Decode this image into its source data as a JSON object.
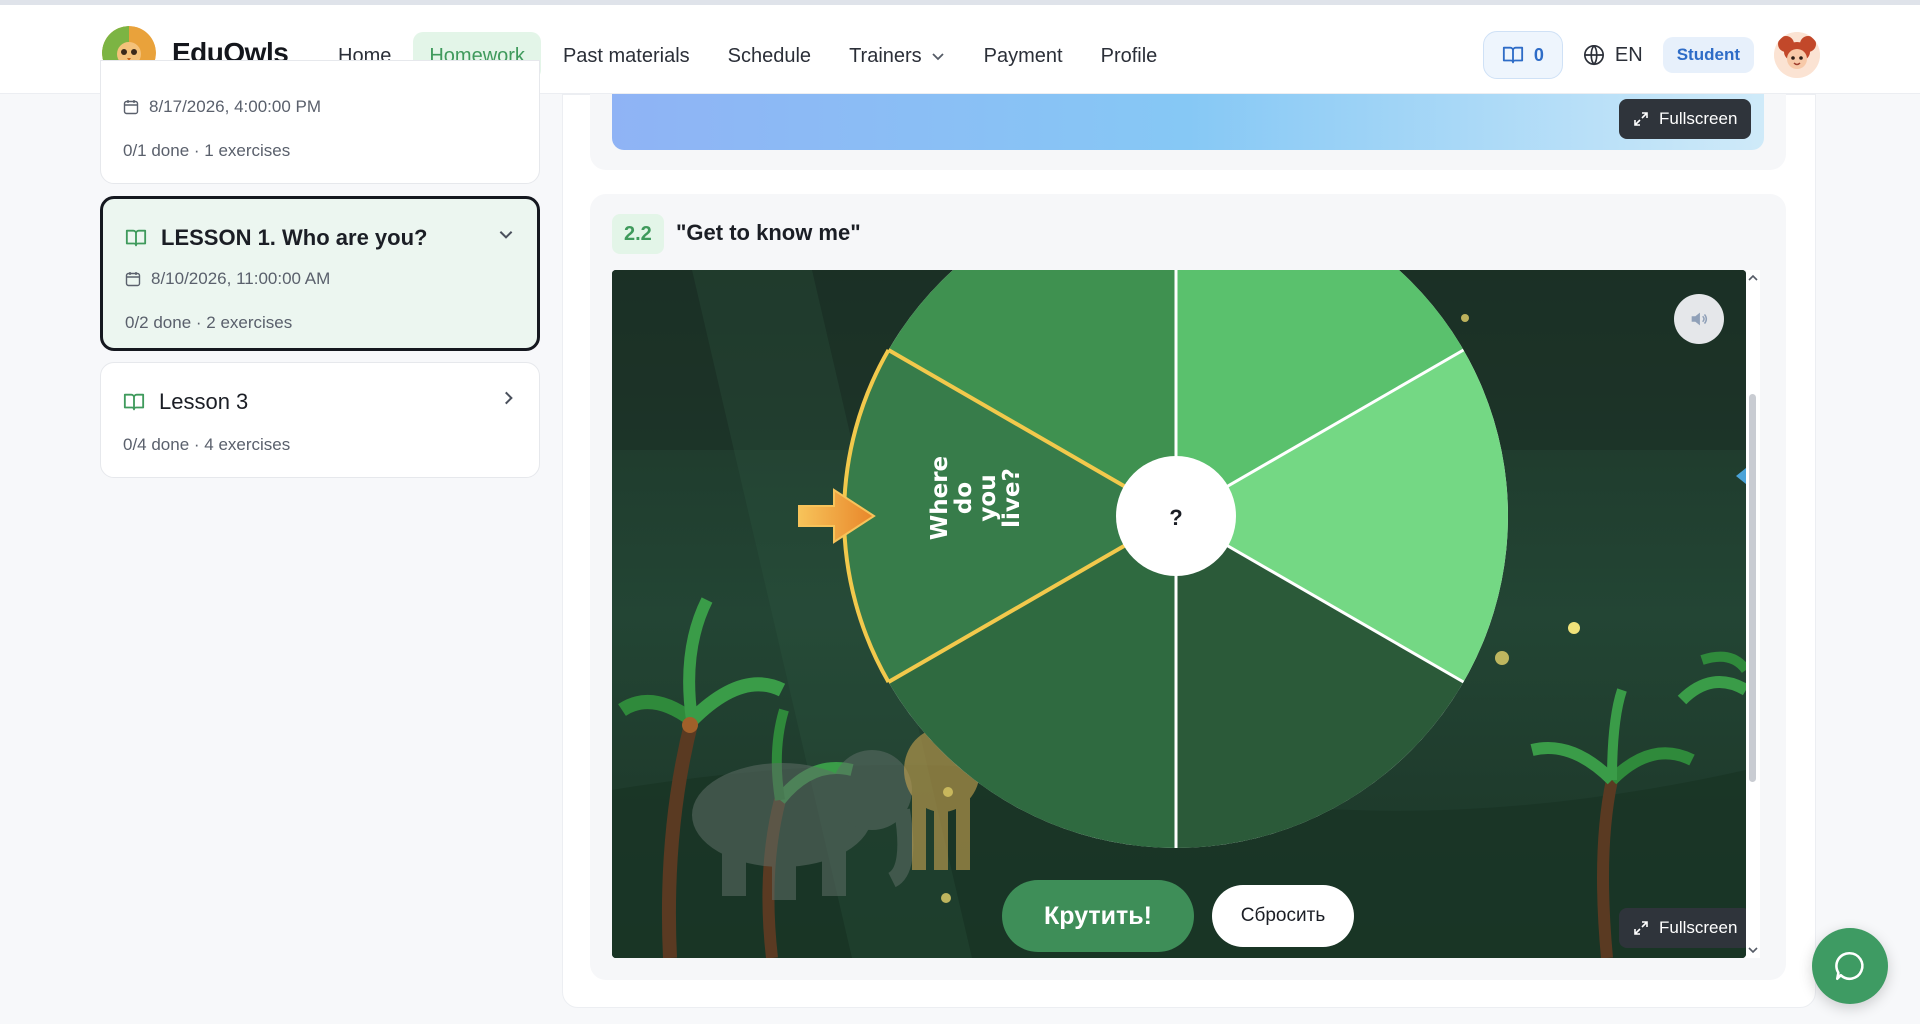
{
  "app": {
    "name": "EduOwls"
  },
  "nav": {
    "items": [
      {
        "label": "Home"
      },
      {
        "label": "Homework",
        "active": true
      },
      {
        "label": "Past materials"
      },
      {
        "label": "Schedule"
      },
      {
        "label": "Trainers",
        "has_dropdown": true
      },
      {
        "label": "Payment"
      },
      {
        "label": "Profile"
      }
    ]
  },
  "header": {
    "book_count": "0",
    "language": "EN",
    "role": "Student"
  },
  "sidebar": {
    "lessons": [
      {
        "date": "8/17/2026, 4:00:00 PM",
        "meta": "0/1 done · 1 exercises"
      },
      {
        "title": "LESSON 1. Who are you?",
        "date": "8/10/2026, 11:00:00 AM",
        "meta": "0/2 done · 2 exercises",
        "expanded": true
      },
      {
        "title": "Lesson 3",
        "meta": "0/4 done · 4 exercises"
      }
    ]
  },
  "exercise": {
    "number": "2.2",
    "title": "\"Get to know me\"",
    "fullscreen_label": "Fullscreen",
    "wheel": {
      "highlighted_question": "Where do you live?",
      "center_glyph": "?"
    },
    "spin_label": "Крутить!",
    "reset_label": "Сбросить"
  },
  "colors": {
    "accent_green": "#3e9b63",
    "active_tab_bg": "#e3f5e8",
    "wheel_light": "#74d884",
    "wheel_mid": "#5ac16d",
    "wheel_dark": "#2b5a39"
  }
}
